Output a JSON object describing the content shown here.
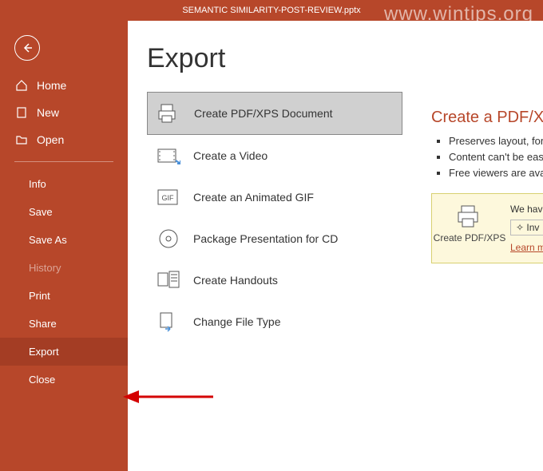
{
  "titlebar": {
    "filename": "SEMANTIC SIMILARITY-POST-REVIEW.pptx"
  },
  "watermark": "www.wintips.org",
  "sidebar": {
    "primary": [
      {
        "label": "Home"
      },
      {
        "label": "New"
      },
      {
        "label": "Open"
      }
    ],
    "secondary": [
      {
        "label": "Info"
      },
      {
        "label": "Save"
      },
      {
        "label": "Save As"
      },
      {
        "label": "History"
      },
      {
        "label": "Print"
      },
      {
        "label": "Share"
      },
      {
        "label": "Export"
      },
      {
        "label": "Close"
      }
    ]
  },
  "page": {
    "title": "Export"
  },
  "exportOptions": [
    {
      "label": "Create PDF/XPS Document"
    },
    {
      "label": "Create a Video"
    },
    {
      "label": "Create an Animated GIF"
    },
    {
      "label": "Package Presentation for CD"
    },
    {
      "label": "Create Handouts"
    },
    {
      "label": "Change File Type"
    }
  ],
  "detail": {
    "heading": "Create a PDF/X",
    "bullets": [
      "Preserves layout, forma",
      "Content can't be easily",
      "Free viewers are availa"
    ],
    "promoButtonLabel": "Create PDF/XPS",
    "promoLine1": "We have",
    "promoLine2": "Inv",
    "promoLearn": "Learn m"
  }
}
